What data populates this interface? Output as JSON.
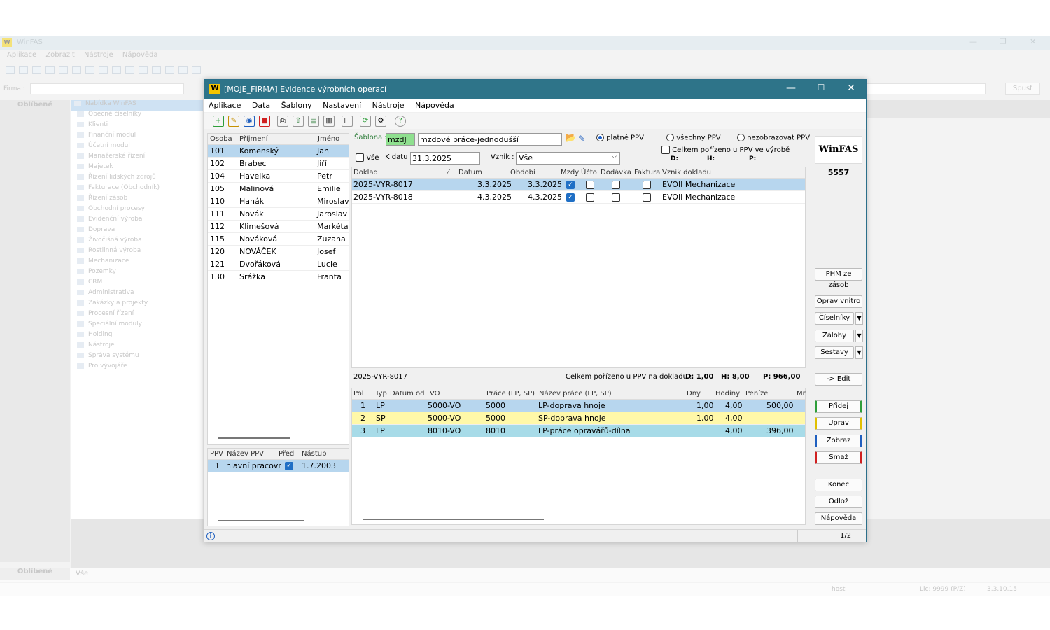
{
  "bg": {
    "title": "WinFAS",
    "menu": [
      "Aplikace",
      "Zobrazit",
      "Nástroje",
      "Nápověda"
    ],
    "firma_label": "Firma :",
    "spust": "Spusť",
    "favorites": "Oblíbené",
    "all": "Vše",
    "user": "host",
    "license": "Lic: 9999 (P/Z)",
    "version": "3.3.10.15",
    "tree": [
      "Nabídka WinFAS",
      "Obecné číselníky",
      "Klienti",
      "Finanční modul",
      "Účetní modul",
      "Manažerské řízení",
      "Majetek",
      "Řízení lidských zdrojů",
      "Fakturace (Obchodník)",
      "Řízení zásob",
      "Obchodní procesy",
      "Evidenční výroba",
      "Doprava",
      "Živočišná výroba",
      "Rostlinná výroba",
      "Mechanizace",
      "Pozemky",
      "CRM",
      "Administrativa",
      "Zakázky a projekty",
      "Procesní řízení",
      "Speciální moduly",
      "Holding",
      "Nástroje",
      "Správa systému",
      "Pro vývojáře"
    ]
  },
  "win": {
    "title": "[MOJE_FIRMA] Evidence výrobních operací",
    "menu": [
      "Aplikace",
      "Data",
      "Šablony",
      "Nastavení",
      "Nástroje",
      "Nápověda"
    ]
  },
  "persons": {
    "headers": [
      "Osoba",
      "Příjmení",
      "Jméno"
    ],
    "rows": [
      [
        "101",
        "Komenský",
        "Jan"
      ],
      [
        "102",
        "Brabec",
        "Jiří"
      ],
      [
        "104",
        "Havelka",
        "Petr"
      ],
      [
        "105",
        "Malinová",
        "Emilie"
      ],
      [
        "110",
        "Hanák",
        "Miroslav"
      ],
      [
        "111",
        "Novák",
        "Jaroslav"
      ],
      [
        "112",
        "Klimešová",
        "Markéta"
      ],
      [
        "115",
        "Nováková",
        "Zuzana"
      ],
      [
        "120",
        "NOVÁČEK",
        "Josef"
      ],
      [
        "121",
        "Dvořáková",
        "Lucie"
      ],
      [
        "130",
        "Srážka",
        "Franta"
      ]
    ]
  },
  "ppv": {
    "headers": [
      "PPV",
      "Název PPV",
      "Před",
      "Nástup"
    ],
    "rows": [
      [
        "1",
        "hlavní pracovr",
        "1.7.2003"
      ]
    ]
  },
  "filter": {
    "sablona_label": "Šablona :",
    "sablona_code": "mzdJ",
    "sablona_name": "mzdové práce-jednodušší",
    "radio1": "platné PPV",
    "radio2": "všechny PPV",
    "radio3": "nezobrazovat PPV",
    "vse": "Vše",
    "kdatu_label": "K datu :",
    "kdatu": "31.3.2025",
    "vznik_label": "Vznik :",
    "vznik": "Vše",
    "celkem_label": "Celkem pořízeno u PPV ve výrobě",
    "d": "D:",
    "h": "H:",
    "p": "P:"
  },
  "docs": {
    "headers": [
      "Doklad",
      "Datum",
      "Období",
      "Mzdy",
      "Účto",
      "Dodávka",
      "Faktura",
      "Vznik dokladu"
    ],
    "rows": [
      [
        "2025-VYR-8017",
        "3.3.2025",
        "3.3.2025",
        "EVOII Mechanizace"
      ],
      [
        "2025-VYR-8018",
        "4.3.2025",
        "4.3.2025",
        "EVOII Mechanizace"
      ]
    ]
  },
  "summary": {
    "doc": "2025-VYR-8017",
    "label": "Celkem pořízeno u PPV na dokladu :",
    "d": "D: 1,00",
    "h": "H: 8,00",
    "p": "P: 966,00"
  },
  "items": {
    "headers": [
      "Pol",
      "Typ",
      "Datum od",
      "VO",
      "Práce (LP, SP)",
      "Název práce (LP, SP)",
      "Dny",
      "Hodiny",
      "Peníze",
      "Mr"
    ],
    "rows": [
      [
        "1",
        "LP",
        "5000-VO",
        "5000",
        "LP-doprava hnoje",
        "1,00",
        "4,00",
        "500,00"
      ],
      [
        "2",
        "SP",
        "5000-VO",
        "5000",
        "SP-doprava hnoje",
        "1,00",
        "4,00",
        ""
      ],
      [
        "3",
        "LP",
        "8010-VO",
        "8010",
        "LP-práce opravářů-dílna",
        "",
        "4,00",
        "396,00"
      ]
    ]
  },
  "side": {
    "brand": "WinFAS",
    "number": "5557",
    "phm": "PHM ze zásob",
    "oprav": "Oprav vnitro",
    "ciselniky": "Číselníky",
    "zalohy": "Zálohy",
    "sestavy": "Sestavy",
    "edit": "-> Edit",
    "pridej": "Přidej",
    "uprav": "Uprav",
    "zobraz": "Zobraz",
    "smaz": "Smaž",
    "konec": "Konec",
    "odloz": "Odlož",
    "napoveda": "Nápověda"
  },
  "status": {
    "page": "1/2"
  },
  "colors": {
    "titlebar": "#2e7489",
    "selection": "#b7d6ee",
    "highlight": "#fff8a8",
    "cyan": "#a7dbe8",
    "green": "#2e9e3a",
    "yellow": "#e0c000",
    "blue": "#1f5fbf",
    "red": "#d02020"
  }
}
